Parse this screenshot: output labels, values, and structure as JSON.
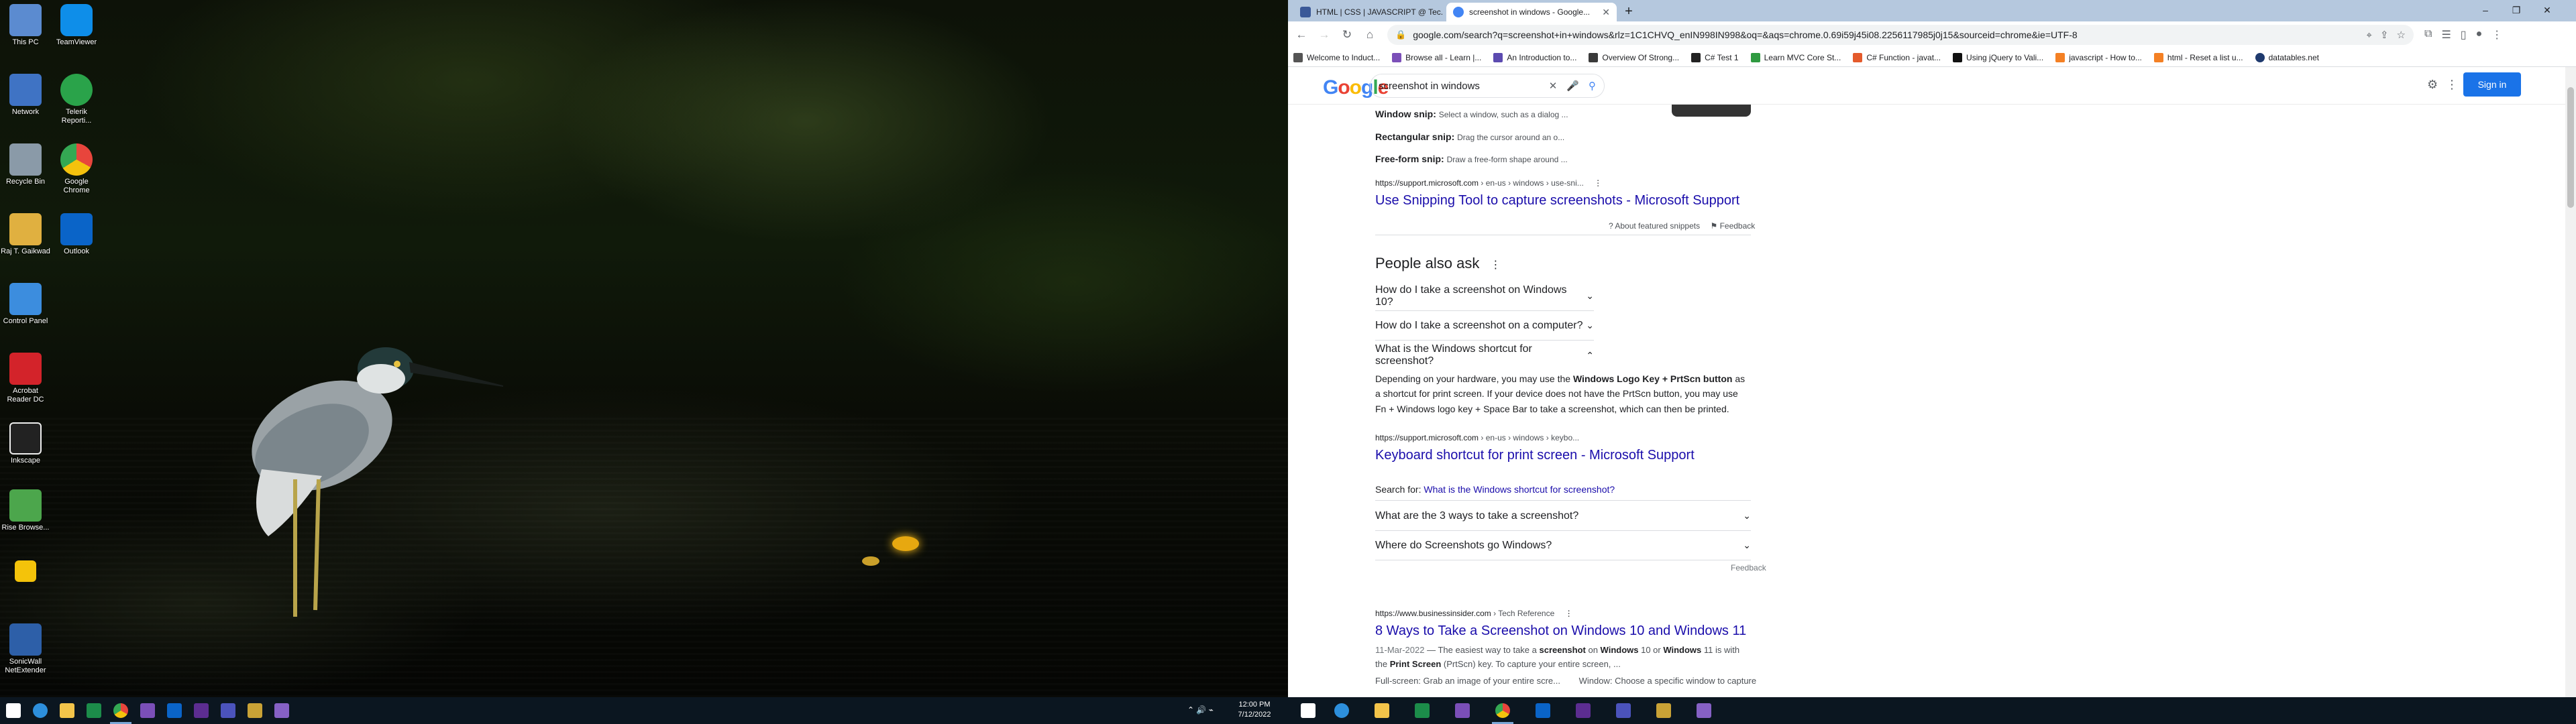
{
  "desktop": {
    "icons": [
      {
        "label": "This PC",
        "color": "#5b8bd0"
      },
      {
        "label": "TeamViewer",
        "color": "#0e8ee9"
      },
      {
        "label": "Network",
        "color": "#3f73c4"
      },
      {
        "label": "Telerik Reporti...",
        "color": "#2aa34a"
      },
      {
        "label": "Recycle Bin",
        "color": "#8a9aa8"
      },
      {
        "label": "Google Chrome",
        "color": "#e8453c"
      },
      {
        "label": "Raj T. Gaikwad",
        "color": "#e0b040"
      },
      {
        "label": "Outlook",
        "color": "#0a64c8"
      },
      {
        "label": "Control Panel",
        "color": "#3c8dde"
      },
      {
        "label": "Acrobat Reader DC",
        "color": "#d3232a"
      },
      {
        "label": "Inkscape",
        "color": "#222222"
      },
      {
        "label": "Rise Browse...",
        "color": "#4ca64c"
      },
      {
        "label": "",
        "color": "#f4c30a"
      },
      {
        "label": "SonicWall NetExtender",
        "color": "#2d5fa8"
      }
    ]
  },
  "browser": {
    "tabs": [
      {
        "title": "HTML | CSS | JAVASCRIPT @ Tec...",
        "fav_color": "#3b5998"
      },
      {
        "title": "screenshot in windows - Google...",
        "fav_color": "#4285f4"
      }
    ],
    "url": "google.com/search?q=screenshot+in+windows&rlz=1C1CHVQ_enIN998IN998&oq=&aqs=chrome.0.69i59j45i08.2256117985j0j15&sourceid=chrome&ie=UTF-8",
    "bookmarks": [
      {
        "label": "Welcome to Induct...",
        "color": "#555555"
      },
      {
        "label": "Browse all - Learn |...",
        "color": "#7b4fb8"
      },
      {
        "label": "An Introduction to...",
        "color": "#5c4bb0"
      },
      {
        "label": "Overview Of Strong...",
        "color": "#3a3a3a"
      },
      {
        "label": "C# Test 1",
        "color": "#222222"
      },
      {
        "label": "Learn MVC Core St...",
        "color": "#2f9a40"
      },
      {
        "label": "C# Function - javat...",
        "color": "#e45a2b"
      },
      {
        "label": "Using jQuery to Vali...",
        "color": "#111111"
      },
      {
        "label": "javascript - How to...",
        "color": "#f48024"
      },
      {
        "label": "html - Reset a list u...",
        "color": "#f48024"
      },
      {
        "label": "datatables.net",
        "color": "#1f3a6e"
      }
    ],
    "google": {
      "logo": "Google",
      "query": "screenshot in windows",
      "signin": "Sign in"
    },
    "snippet": {
      "items": [
        {
          "title": "Window snip:",
          "text": "Select a window, such as a dialog ..."
        },
        {
          "title": "Rectangular snip:",
          "text": "Drag the cursor around an o..."
        },
        {
          "title": "Free-form snip:",
          "text": "Draw a free-form shape around ..."
        }
      ],
      "cite_domain": "https://support.microsoft.com",
      "cite_path": " › en-us › windows › use-sni...",
      "link": "Use Snipping Tool to capture screenshots - Microsoft Support",
      "about": "About featured snippets",
      "feedback": "Feedback"
    },
    "paa": {
      "heading": "People also ask",
      "questions": [
        "How do I take a screenshot on Windows 10?",
        "How do I take a screenshot on a computer?",
        "What is the Windows shortcut for screenshot?"
      ],
      "answer_pre": "Depending on your hardware, you may use the ",
      "answer_bold": "Windows Logo Key + PrtScn button",
      "answer_post": " as a shortcut for print screen. If your device does not have the PrtScn button, you may use Fn + Windows logo key + Space Bar to take a screenshot, which can then be printed.",
      "answer_cite_domain": "https://support.microsoft.com",
      "answer_cite_path": " › en-us › windows › keybo...",
      "answer_link": "Keyboard shortcut for print screen - Microsoft Support",
      "search_for_label": "Search for:",
      "search_for_link": "What is the Windows shortcut for screenshot?",
      "more_questions": [
        "What are the 3 ways to take a screenshot?",
        "Where do Screenshots go Windows?"
      ],
      "feedback": "Feedback"
    },
    "result": {
      "cite_domain": "https://www.businessinsider.com",
      "cite_path": " › Tech Reference",
      "link": "8 Ways to Take a Screenshot on Windows 10 and Windows 11",
      "date": "11-Mar-2022",
      "snippet_pre": " — The easiest way to take a ",
      "snippet_b1": "screenshot",
      "snippet_mid": " on ",
      "snippet_b2": "Windows",
      "snippet_mid2": " 10 or ",
      "snippet_b3": "Windows",
      "snippet_mid3": " 11 is with the ",
      "snippet_b4": "Print Screen",
      "snippet_post": " (PrtScn) key. To capture your entire screen, ...",
      "sitelink1": "Full-screen: Grab an image of your entire scre...",
      "sitelink2": "Window: Choose a specific window to capture"
    }
  },
  "taskbar": {
    "time": "12:00 PM",
    "date": "7/12/2022"
  }
}
